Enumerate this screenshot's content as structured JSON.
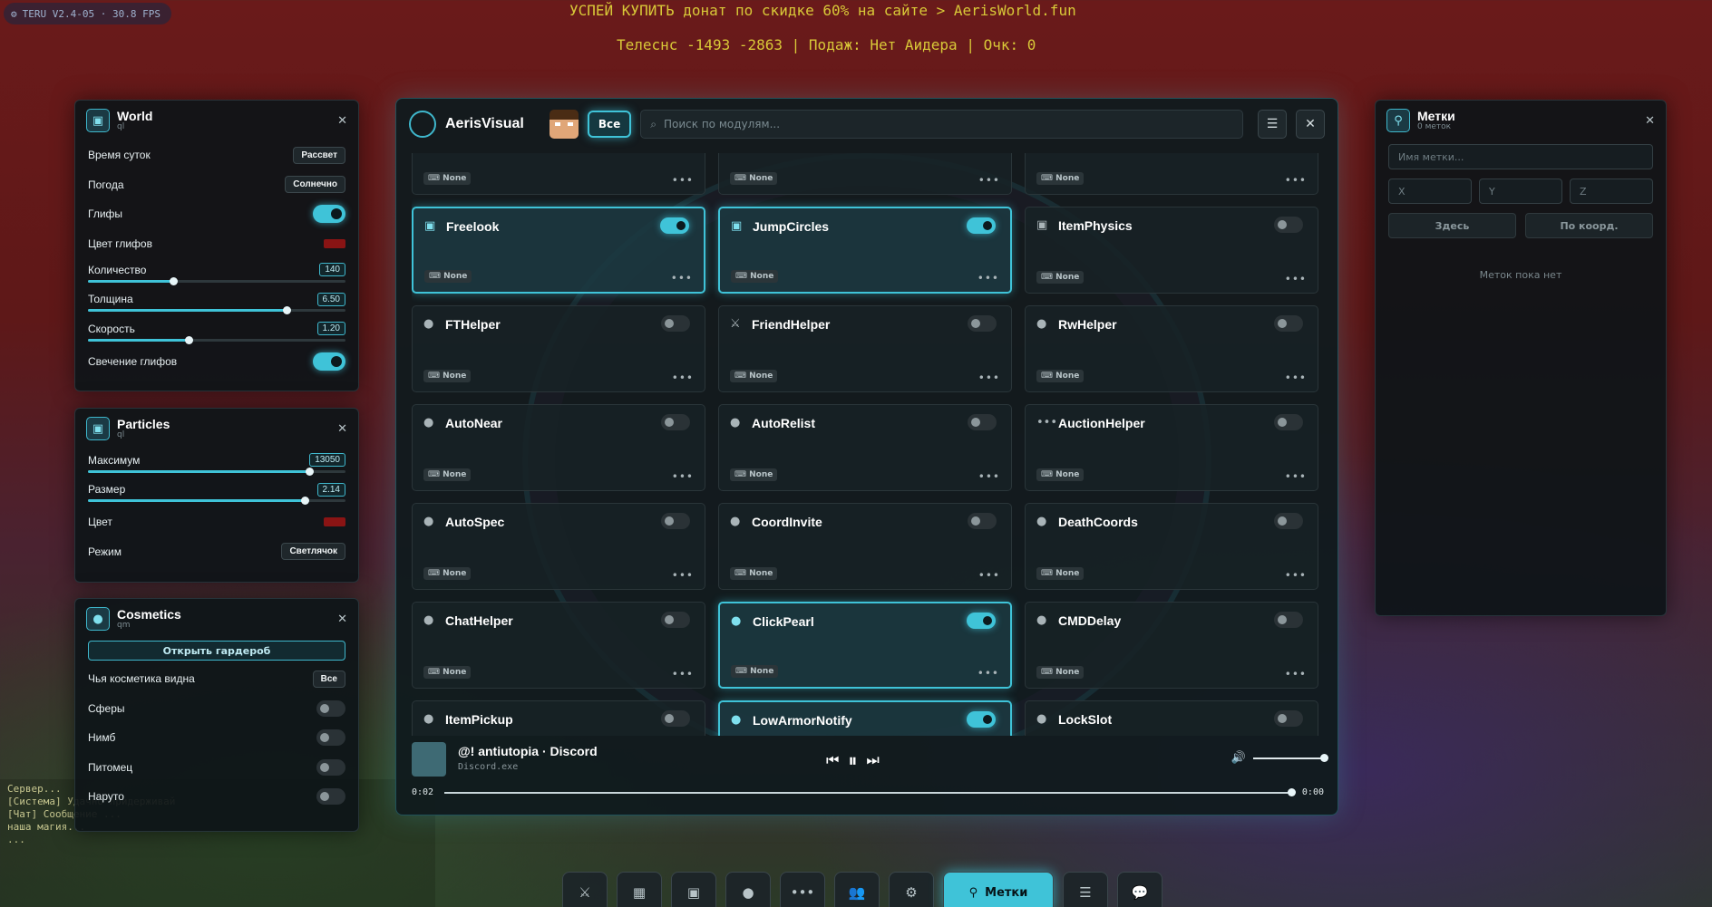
{
  "hud": {
    "fps": "TERU V2.4-05 · 30.8 FPS",
    "promo": "УСПЕЙ КУПИТЬ донат по скидке 60% на сайте > AerisWorld.fun",
    "status": "Телеснс -1493 -2863 | Подаж: Нет Аидера | Очк: 0"
  },
  "chat": [
    "Сервер...",
    "[Система] Удачно придерживай",
    "[Чат] Сообщение ...",
    "наша магия...",
    "..."
  ],
  "world": {
    "title": "World",
    "sub": "ql",
    "time_label": "Время суток",
    "time_val": "Рассвет",
    "weather_label": "Погода",
    "weather_val": "Солнечно",
    "glyphs_label": "Глифы",
    "glyph_color_label": "Цвет глифов",
    "count_label": "Количество",
    "count_val": "140",
    "count_pct": 33,
    "thick_label": "Толщина",
    "thick_val": "6.50",
    "thick_pct": 77,
    "speed_label": "Скорость",
    "speed_val": "1.20",
    "speed_pct": 39,
    "glow_label": "Свечение глифов"
  },
  "particles": {
    "title": "Particles",
    "sub": "ql",
    "max_label": "Максимум",
    "max_val": "13050",
    "max_pct": 86,
    "size_label": "Размер",
    "size_val": "2.14",
    "size_pct": 84,
    "color_label": "Цвет",
    "mode_label": "Режим",
    "mode_val": "Светлячок"
  },
  "cosmetics": {
    "title": "Cosmetics",
    "sub": "qm",
    "wardrobe": "Открыть гардероб",
    "whose_label": "Чья косметика видна",
    "whose_val": "Все",
    "spheres": "Сферы",
    "halo": "Нимб",
    "pet": "Питомец",
    "naruto": "Наруто"
  },
  "main": {
    "brand": "AerisVisual",
    "all": "Все",
    "search_placeholder": "Поиск по модулям...",
    "bind": "None",
    "modules": [
      {
        "name": "",
        "icon": "image-icon",
        "on": false
      },
      {
        "name": "",
        "icon": "image-icon",
        "on": false
      },
      {
        "name": "",
        "icon": "image-icon",
        "on": false
      },
      {
        "name": "Freelook",
        "icon": "image-icon",
        "on": true
      },
      {
        "name": "JumpCircles",
        "icon": "image-icon",
        "on": true
      },
      {
        "name": "ItemPhysics",
        "icon": "image-icon",
        "on": false
      },
      {
        "name": "FTHelper",
        "icon": "user-icon",
        "on": false
      },
      {
        "name": "FriendHelper",
        "icon": "sword-icon",
        "on": false
      },
      {
        "name": "RwHelper",
        "icon": "user-icon",
        "on": false
      },
      {
        "name": "AutoNear",
        "icon": "user-icon",
        "on": false
      },
      {
        "name": "AutoRelist",
        "icon": "user-icon",
        "on": false
      },
      {
        "name": "AuctionHelper",
        "icon": "dots-icon",
        "on": false
      },
      {
        "name": "AutoSpec",
        "icon": "user-icon",
        "on": false
      },
      {
        "name": "CoordInvite",
        "icon": "user-icon",
        "on": false
      },
      {
        "name": "DeathCoords",
        "icon": "user-icon",
        "on": false
      },
      {
        "name": "ChatHelper",
        "icon": "user-icon",
        "on": false
      },
      {
        "name": "ClickPearl",
        "icon": "user-icon",
        "on": true
      },
      {
        "name": "CMDDelay",
        "icon": "user-icon",
        "on": false
      },
      {
        "name": "ItemPickup",
        "icon": "user-icon",
        "on": false
      },
      {
        "name": "LowArmorNotify",
        "icon": "user-icon",
        "on": true
      },
      {
        "name": "LockSlot",
        "icon": "user-icon",
        "on": false
      }
    ],
    "player": {
      "title": "@! antiutopia · Discord",
      "artist": "Discord.exe",
      "elapsed": "0:02",
      "total": "0:00"
    }
  },
  "waypoints": {
    "title": "Метки",
    "sub": "0 меток",
    "name_placeholder": "Имя метки...",
    "x": "X",
    "y": "Y",
    "z": "Z",
    "here": "Здесь",
    "bycoord": "По коорд.",
    "empty": "Меток пока нет"
  },
  "dock": {
    "active_label": "Метки"
  },
  "colors": {
    "accent": "#3fc3d8",
    "glyph_color": "#8a1414"
  }
}
